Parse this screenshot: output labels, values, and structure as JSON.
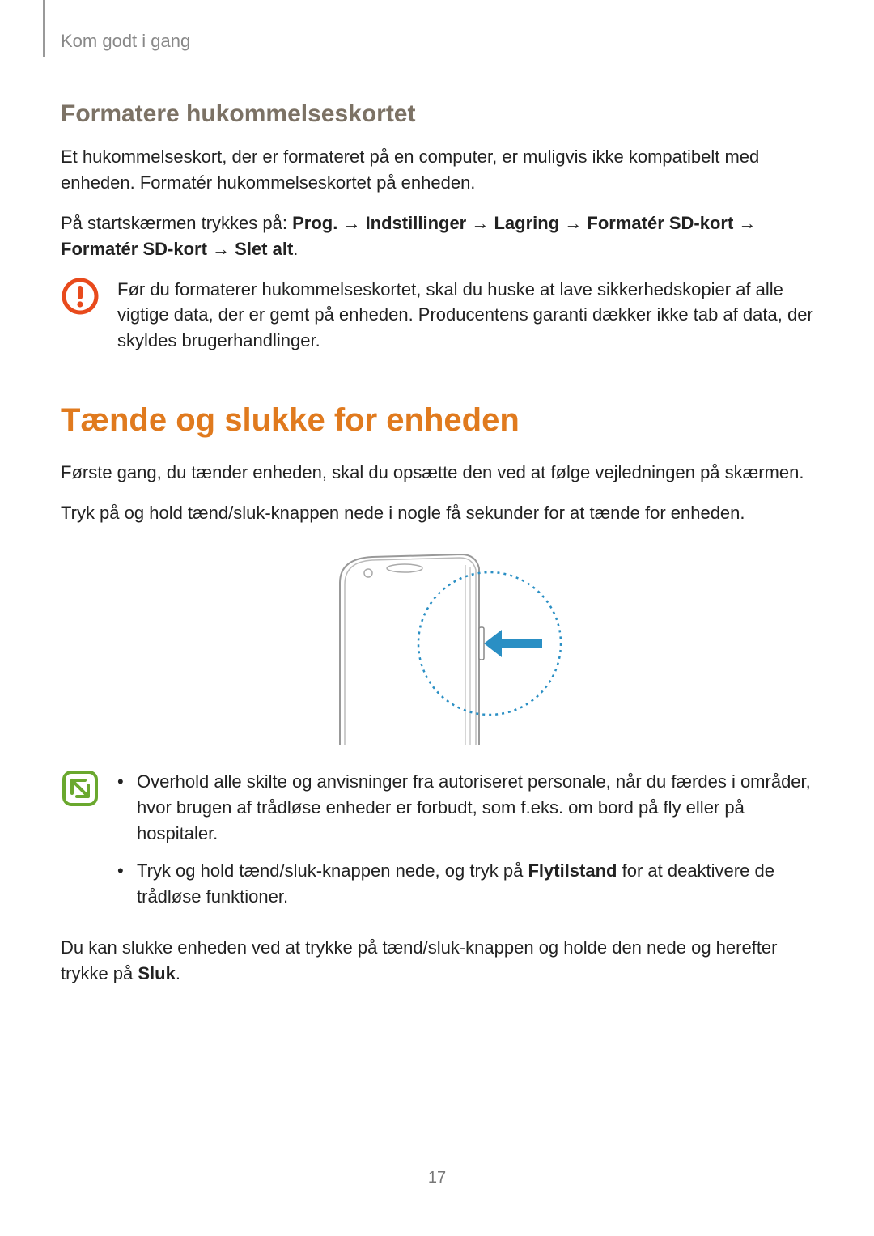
{
  "breadcrumb": "Kom godt i gang",
  "format_section": {
    "heading": "Formatere hukommelseskortet",
    "p1": "Et hukommelseskort, der er formateret på en computer, er muligvis ikke kompatibelt med enheden. Formatér hukommelseskortet på enheden.",
    "p2_prefix": "På startskærmen trykkes på: ",
    "p2_bold1": "Prog.",
    "arrow1": " → ",
    "p2_bold2": "Indstillinger",
    "arrow2": " → ",
    "p2_bold3": "Lagring",
    "arrow3": " → ",
    "p2_bold4": "Formatér SD-kort",
    "arrow4": " → ",
    "p2_bold5": "Formatér SD-kort",
    "arrow5": " → ",
    "p2_bold6": "Slet alt",
    "p2_period": ".",
    "caution_text": "Før du formaterer hukommelseskortet, skal du huske at lave sikkerhedskopier af alle vigtige data, der er gemt på enheden. Producentens garanti dækker ikke tab af data, der skyldes brugerhandlinger."
  },
  "power_section": {
    "heading": "Tænde og slukke for enheden",
    "p1": "Første gang, du tænder enheden, skal du opsætte den ved at følge vejledningen på skærmen.",
    "p2": "Tryk på og hold tænd/sluk-knappen nede i nogle få sekunder for at tænde for enheden.",
    "note_bullet1": "Overhold alle skilte og anvisninger fra autoriseret personale, når du færdes i områder, hvor brugen af trådløse enheder er forbudt, som f.eks. om bord på fly eller på hospitaler.",
    "note_bullet2_pre": "Tryk og hold tænd/sluk-knappen nede, og tryk på ",
    "note_bullet2_bold": "Flytilstand",
    "note_bullet2_post": " for at deaktivere de trådløse funktioner.",
    "p3_pre": "Du kan slukke enheden ved at trykke på tænd/sluk-knappen og holde den nede og herefter trykke på ",
    "p3_bold": "Sluk",
    "p3_post": "."
  },
  "page_number": "17"
}
